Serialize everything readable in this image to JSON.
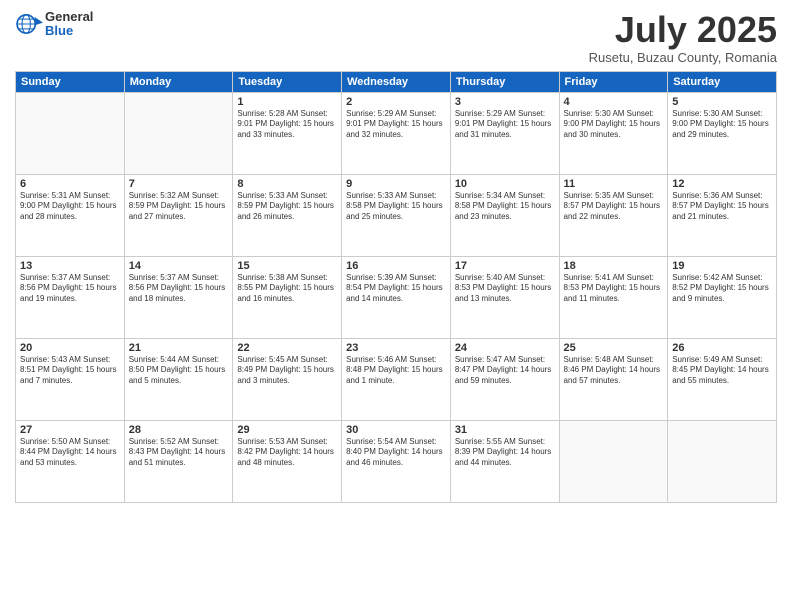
{
  "header": {
    "logo_general": "General",
    "logo_blue": "Blue",
    "month": "July 2025",
    "location": "Rusetu, Buzau County, Romania"
  },
  "days_of_week": [
    "Sunday",
    "Monday",
    "Tuesday",
    "Wednesday",
    "Thursday",
    "Friday",
    "Saturday"
  ],
  "weeks": [
    [
      {
        "day": "",
        "info": ""
      },
      {
        "day": "",
        "info": ""
      },
      {
        "day": "1",
        "info": "Sunrise: 5:28 AM\nSunset: 9:01 PM\nDaylight: 15 hours and 33 minutes."
      },
      {
        "day": "2",
        "info": "Sunrise: 5:29 AM\nSunset: 9:01 PM\nDaylight: 15 hours and 32 minutes."
      },
      {
        "day": "3",
        "info": "Sunrise: 5:29 AM\nSunset: 9:01 PM\nDaylight: 15 hours and 31 minutes."
      },
      {
        "day": "4",
        "info": "Sunrise: 5:30 AM\nSunset: 9:00 PM\nDaylight: 15 hours and 30 minutes."
      },
      {
        "day": "5",
        "info": "Sunrise: 5:30 AM\nSunset: 9:00 PM\nDaylight: 15 hours and 29 minutes."
      }
    ],
    [
      {
        "day": "6",
        "info": "Sunrise: 5:31 AM\nSunset: 9:00 PM\nDaylight: 15 hours and 28 minutes."
      },
      {
        "day": "7",
        "info": "Sunrise: 5:32 AM\nSunset: 8:59 PM\nDaylight: 15 hours and 27 minutes."
      },
      {
        "day": "8",
        "info": "Sunrise: 5:33 AM\nSunset: 8:59 PM\nDaylight: 15 hours and 26 minutes."
      },
      {
        "day": "9",
        "info": "Sunrise: 5:33 AM\nSunset: 8:58 PM\nDaylight: 15 hours and 25 minutes."
      },
      {
        "day": "10",
        "info": "Sunrise: 5:34 AM\nSunset: 8:58 PM\nDaylight: 15 hours and 23 minutes."
      },
      {
        "day": "11",
        "info": "Sunrise: 5:35 AM\nSunset: 8:57 PM\nDaylight: 15 hours and 22 minutes."
      },
      {
        "day": "12",
        "info": "Sunrise: 5:36 AM\nSunset: 8:57 PM\nDaylight: 15 hours and 21 minutes."
      }
    ],
    [
      {
        "day": "13",
        "info": "Sunrise: 5:37 AM\nSunset: 8:56 PM\nDaylight: 15 hours and 19 minutes."
      },
      {
        "day": "14",
        "info": "Sunrise: 5:37 AM\nSunset: 8:56 PM\nDaylight: 15 hours and 18 minutes."
      },
      {
        "day": "15",
        "info": "Sunrise: 5:38 AM\nSunset: 8:55 PM\nDaylight: 15 hours and 16 minutes."
      },
      {
        "day": "16",
        "info": "Sunrise: 5:39 AM\nSunset: 8:54 PM\nDaylight: 15 hours and 14 minutes."
      },
      {
        "day": "17",
        "info": "Sunrise: 5:40 AM\nSunset: 8:53 PM\nDaylight: 15 hours and 13 minutes."
      },
      {
        "day": "18",
        "info": "Sunrise: 5:41 AM\nSunset: 8:53 PM\nDaylight: 15 hours and 11 minutes."
      },
      {
        "day": "19",
        "info": "Sunrise: 5:42 AM\nSunset: 8:52 PM\nDaylight: 15 hours and 9 minutes."
      }
    ],
    [
      {
        "day": "20",
        "info": "Sunrise: 5:43 AM\nSunset: 8:51 PM\nDaylight: 15 hours and 7 minutes."
      },
      {
        "day": "21",
        "info": "Sunrise: 5:44 AM\nSunset: 8:50 PM\nDaylight: 15 hours and 5 minutes."
      },
      {
        "day": "22",
        "info": "Sunrise: 5:45 AM\nSunset: 8:49 PM\nDaylight: 15 hours and 3 minutes."
      },
      {
        "day": "23",
        "info": "Sunrise: 5:46 AM\nSunset: 8:48 PM\nDaylight: 15 hours and 1 minute."
      },
      {
        "day": "24",
        "info": "Sunrise: 5:47 AM\nSunset: 8:47 PM\nDaylight: 14 hours and 59 minutes."
      },
      {
        "day": "25",
        "info": "Sunrise: 5:48 AM\nSunset: 8:46 PM\nDaylight: 14 hours and 57 minutes."
      },
      {
        "day": "26",
        "info": "Sunrise: 5:49 AM\nSunset: 8:45 PM\nDaylight: 14 hours and 55 minutes."
      }
    ],
    [
      {
        "day": "27",
        "info": "Sunrise: 5:50 AM\nSunset: 8:44 PM\nDaylight: 14 hours and 53 minutes."
      },
      {
        "day": "28",
        "info": "Sunrise: 5:52 AM\nSunset: 8:43 PM\nDaylight: 14 hours and 51 minutes."
      },
      {
        "day": "29",
        "info": "Sunrise: 5:53 AM\nSunset: 8:42 PM\nDaylight: 14 hours and 48 minutes."
      },
      {
        "day": "30",
        "info": "Sunrise: 5:54 AM\nSunset: 8:40 PM\nDaylight: 14 hours and 46 minutes."
      },
      {
        "day": "31",
        "info": "Sunrise: 5:55 AM\nSunset: 8:39 PM\nDaylight: 14 hours and 44 minutes."
      },
      {
        "day": "",
        "info": ""
      },
      {
        "day": "",
        "info": ""
      }
    ]
  ]
}
